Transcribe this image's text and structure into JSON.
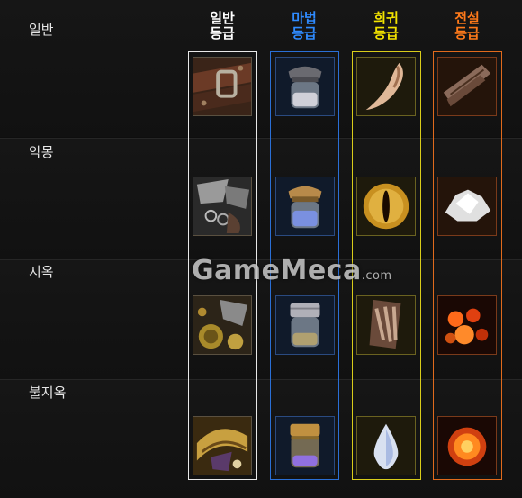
{
  "rows": [
    {
      "label": "일반"
    },
    {
      "label": "악몽"
    },
    {
      "label": "지옥"
    },
    {
      "label": "불지옥"
    }
  ],
  "grades": [
    {
      "line1": "일반",
      "line2": "등급",
      "color": "#ffffff"
    },
    {
      "line1": "마법",
      "line2": "등급",
      "color": "#2f8bff"
    },
    {
      "line1": "희귀",
      "line2": "등급",
      "color": "#f2e300"
    },
    {
      "line1": "전설",
      "line2": "등급",
      "color": "#ff7a1a"
    }
  ],
  "items": {
    "normal": [
      "leather-belt-icon",
      "scrap-metal-icon",
      "ornate-armor-scrap-icon",
      "gilded-scale-scrap-icon"
    ],
    "magic": [
      "gray-dust-jar-icon",
      "blue-dust-jar-icon",
      "metal-dust-jar-icon",
      "purple-dust-jar-icon"
    ],
    "rare": [
      "curved-fang-icon",
      "demon-eye-icon",
      "claw-icon",
      "tear-drop-icon"
    ],
    "legendary": [
      "wood-plank-icon",
      "white-crystal-icon",
      "embers-icon",
      "fire-orb-icon"
    ]
  },
  "watermark": {
    "text": "GameMeca",
    "suffix": ".com"
  }
}
